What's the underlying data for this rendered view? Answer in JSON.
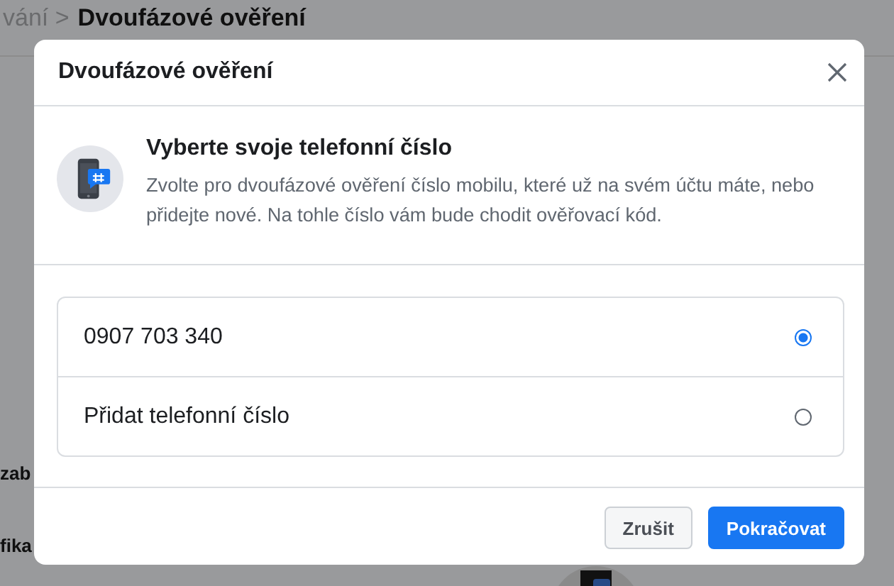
{
  "background": {
    "breadcrumb": {
      "parent": "vání >",
      "current": "Dvoufázové ověření"
    },
    "section_title": "zab",
    "section_label": "fika"
  },
  "dialog": {
    "title": "Dvoufázové ověření",
    "heading": "Vyberte svoje telefonní číslo",
    "description": "Zvolte pro dvoufázové ověření číslo mobilu, které už na svém účtu máte, nebo přidejte nové. Na tohle číslo vám bude chodit ověřovací kód.",
    "options": [
      {
        "label": "0907 703 340",
        "selected": true
      },
      {
        "label": "Přidat telefonní číslo",
        "selected": false
      }
    ],
    "buttons": [
      {
        "label": "Zrušit",
        "kind": "secondary"
      },
      {
        "label": "Pokračovat",
        "kind": "primary"
      }
    ]
  }
}
